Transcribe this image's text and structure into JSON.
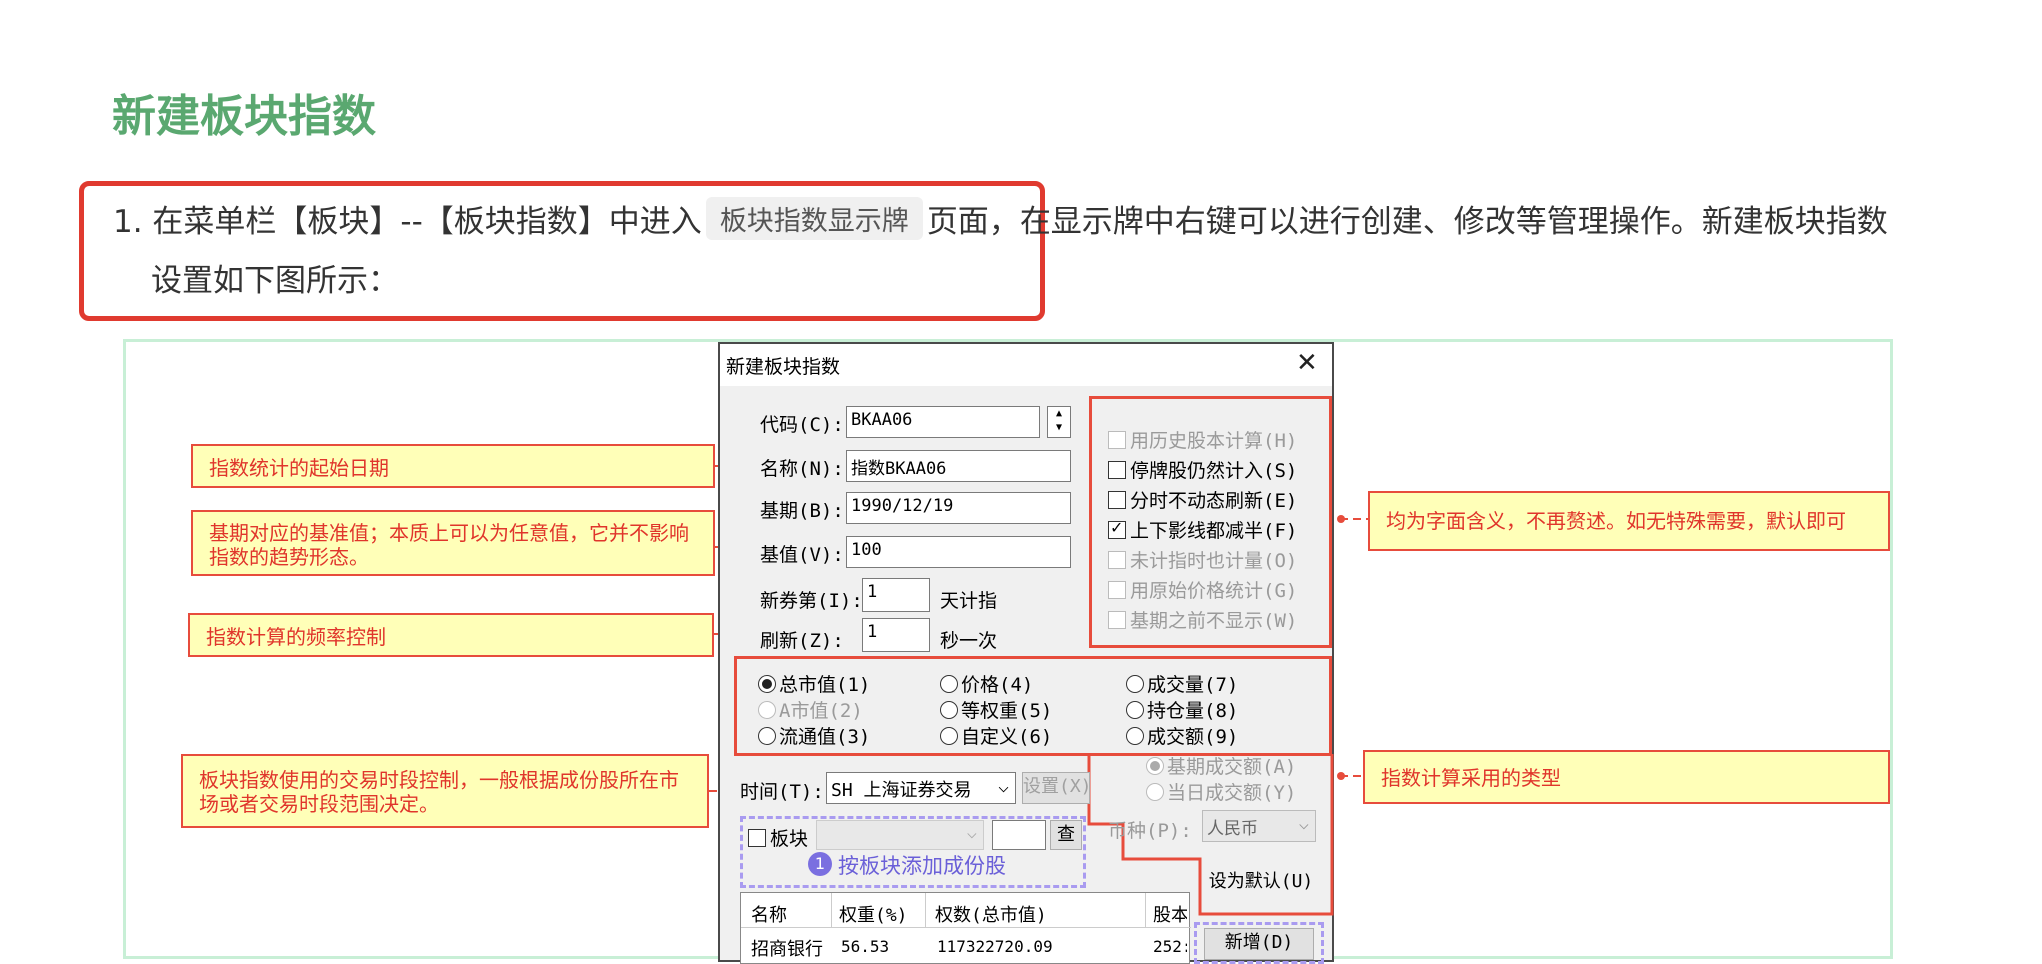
{
  "page": {
    "title": "新建板块指数",
    "intro_part1": "1. 在菜单栏【板块】--【板块指数】中进入",
    "intro_code": "板块指数显示牌",
    "intro_part2": "页面，",
    "intro_part3": "在显示牌中右键可以进行创建、修改等管理操作。新建板块指数",
    "intro_line2": "设置如下图所示："
  },
  "callouts": {
    "start_date": "指数统计的起始日期",
    "base_value": "基期对应的基准值；本质上可以为任意值，它并不影响指数的趋势形态。",
    "frequency": "指数计算的频率控制",
    "session": "板块指数使用的交易时段控制，一般根据成份股所在市场或者交易时段范围决定。",
    "options": "均为字面含义，不再赘述。如无特殊需要，默认即可",
    "calc_type": "指数计算采用的类型"
  },
  "dialog": {
    "title": "新建板块指数",
    "code_label": "代码(C):",
    "code_value": "BKAA06",
    "name_label": "名称(N):",
    "name_value": "指数BKAA06",
    "base_date_label": "基期(B):",
    "base_date_value": "1990/12/19",
    "base_value_label": "基值(V):",
    "base_value_value": "100",
    "new_stock_label": "新券第(I):",
    "new_stock_value": "1",
    "new_stock_suffix": "天计指",
    "refresh_label": "刷新(Z):",
    "refresh_value": "1",
    "refresh_suffix": "秒一次",
    "options": [
      {
        "label": "用历史股本计算(H)",
        "checked": false,
        "disabled": true
      },
      {
        "label": "停牌股仍然计入(S)",
        "checked": false,
        "disabled": false
      },
      {
        "label": "分时不动态刷新(E)",
        "checked": false,
        "disabled": false
      },
      {
        "label": "上下影线都减半(F)",
        "checked": true,
        "disabled": false
      },
      {
        "label": "未计指时也计量(O)",
        "checked": false,
        "disabled": true
      },
      {
        "label": "用原始价格统计(G)",
        "checked": false,
        "disabled": true
      },
      {
        "label": "基期之前不显示(W)",
        "checked": false,
        "disabled": true
      }
    ],
    "weights": {
      "total_cap": "总市值(1)",
      "a_cap": "A市值(2)",
      "float_cap": "流通值(3)",
      "price": "价格(4)",
      "equal": "等权重(5)",
      "custom": "自定义(6)",
      "volume": "成交量(7)",
      "open_interest": "持仓量(8)",
      "turnover": "成交额(9)",
      "base_turnover": "基期成交额(A)",
      "day_turnover": "当日成交额(Y)"
    },
    "time_label": "时间(T):",
    "time_value": "SH 上海证券交易",
    "setting_button": "设置(X)",
    "currency_label": "币种(P):",
    "currency_value": "人民币",
    "block_label": "板块",
    "query_button": "查",
    "add_by_block_badge": "1",
    "add_by_block": "按板块添加成份股",
    "set_default_button": "设为默认(U)",
    "add_button": "新增(D)",
    "table": {
      "headers": [
        "名称",
        "权重(%)",
        "权数(总市值)",
        "股本"
      ],
      "rows": [
        [
          "招商银行",
          "56.53",
          "117322720.09",
          "252:"
        ]
      ]
    }
  }
}
